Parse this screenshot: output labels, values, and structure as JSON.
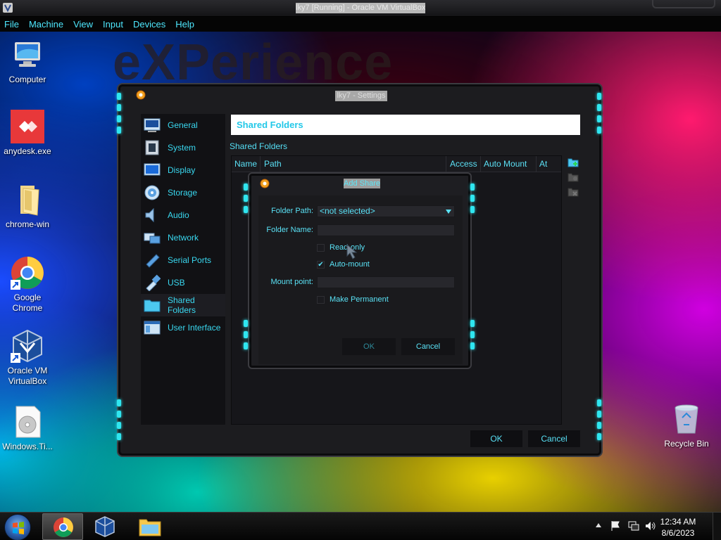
{
  "vm": {
    "title": "lky7 [Running] - Oracle VM VirtualBox",
    "menu": [
      "File",
      "Machine",
      "View",
      "Input",
      "Devices",
      "Help"
    ]
  },
  "wallpaper": {
    "brand": "eXPerience"
  },
  "desktop": {
    "icons": [
      {
        "label": "Computer",
        "icon": "computer-icon"
      },
      {
        "label": "anydesk.exe",
        "icon": "anydesk-icon"
      },
      {
        "label": "chrome-win",
        "icon": "folder-icon"
      },
      {
        "label": "Google Chrome",
        "icon": "chrome-icon"
      },
      {
        "label": "Oracle VM VirtualBox",
        "icon": "virtualbox-icon"
      },
      {
        "label": "Windows.Ti...",
        "icon": "disc-image-icon"
      },
      {
        "label": "Recycle Bin",
        "icon": "recycle-bin-icon"
      }
    ]
  },
  "settings": {
    "title": "lky7 - Settings",
    "nav": [
      {
        "label": "General",
        "icon": "general-icon"
      },
      {
        "label": "System",
        "icon": "system-icon"
      },
      {
        "label": "Display",
        "icon": "display-icon"
      },
      {
        "label": "Storage",
        "icon": "storage-icon"
      },
      {
        "label": "Audio",
        "icon": "audio-icon"
      },
      {
        "label": "Network",
        "icon": "network-icon"
      },
      {
        "label": "Serial Ports",
        "icon": "serial-ports-icon"
      },
      {
        "label": "USB",
        "icon": "usb-icon"
      },
      {
        "label": "Shared Folders",
        "icon": "shared-folders-icon",
        "active": true
      },
      {
        "label": "User Interface",
        "icon": "user-interface-icon"
      }
    ],
    "header": "Shared Folders",
    "section_label": "Shared Folders",
    "columns": [
      "Name",
      "Path",
      "Access",
      "Auto Mount",
      "At"
    ],
    "ok": "OK",
    "cancel": "Cancel"
  },
  "add_share": {
    "title": "Add Share",
    "folder_path_label": "Folder Path:",
    "folder_path_value": "<not selected>",
    "folder_name_label": "Folder Name:",
    "folder_name_value": "",
    "read_only_label": "Read-only",
    "read_only_checked": false,
    "auto_mount_label": "Auto-mount",
    "auto_mount_checked": true,
    "mount_point_label": "Mount point:",
    "mount_point_value": "",
    "make_permanent_label": "Make Permanent",
    "make_permanent_checked": false,
    "ok": "OK",
    "cancel": "Cancel",
    "checkmark": "✔"
  },
  "taskbar": {
    "apps": [
      "chrome-icon",
      "virtualbox-icon",
      "file-explorer-icon"
    ],
    "time": "12:34 AM",
    "date": "8/6/2023"
  },
  "colors": {
    "accent": "#39d8f0",
    "panel": "#1c1c1f"
  }
}
